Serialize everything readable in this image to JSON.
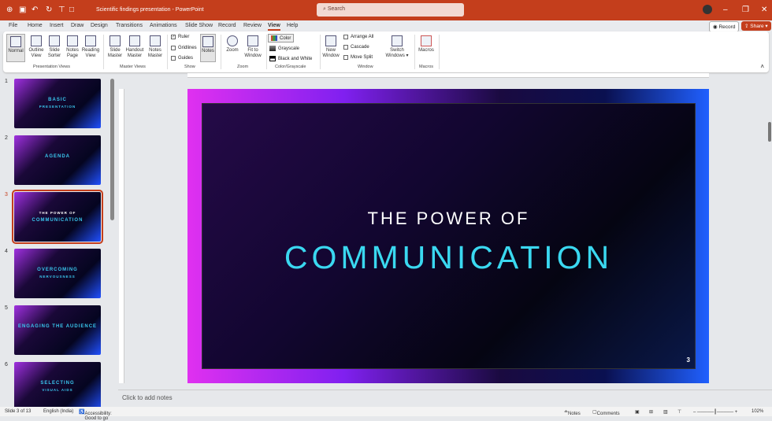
{
  "titlebar": {
    "doc_title": "Scientific findings presentation - PowerPoint",
    "search_placeholder": "Search",
    "record": "Record",
    "share": "Share"
  },
  "menu": [
    "File",
    "Home",
    "Insert",
    "Draw",
    "Design",
    "Transitions",
    "Animations",
    "Slide Show",
    "Record",
    "Review",
    "View",
    "Help"
  ],
  "ribbon": {
    "presentation_views": [
      "Normal",
      "Outline View",
      "Slide Sorter",
      "Notes Page",
      "Reading View"
    ],
    "master_views": [
      "Slide Master",
      "Handout Master",
      "Notes Master"
    ],
    "show": {
      "ruler": "Ruler",
      "gridlines": "Gridlines",
      "guides": "Guides",
      "notes": "Notes"
    },
    "zoom": [
      "Zoom",
      "Fit to Window"
    ],
    "color": [
      "Color",
      "Grayscale",
      "Black and White"
    ],
    "window": {
      "new": "New Window",
      "arrange": "Arrange All",
      "cascade": "Cascade",
      "move": "Move Split",
      "switch": "Switch Windows"
    },
    "macros": "Macros",
    "groups": [
      "Presentation Views",
      "Master Views",
      "Show",
      "Zoom",
      "Color/Grayscale",
      "Window",
      "Macros"
    ]
  },
  "thumbnails": [
    {
      "n": "1",
      "t1": "BASIC",
      "t2": "PRESENTATION"
    },
    {
      "n": "2",
      "t1": "AGENDA",
      "t2": ""
    },
    {
      "n": "3",
      "t1": "THE POWER OF",
      "t2": "COMMUNICATION"
    },
    {
      "n": "4",
      "t1": "OVERCOMING",
      "t2": "NERVOUSNESS"
    },
    {
      "n": "5",
      "t1": "ENGAGING THE AUDIENCE",
      "t2": ""
    },
    {
      "n": "6",
      "t1": "SELECTING",
      "t2": "VISUAL AIDS"
    }
  ],
  "slide": {
    "line1": "THE POWER OF",
    "line2": "COMMUNICATION",
    "number": "3"
  },
  "notes_placeholder": "Click to add notes",
  "status": {
    "slide": "Slide 3 of 13",
    "language": "English (India)",
    "accessibility": "Accessibility: Good to go",
    "notes": "Notes",
    "comments": "Comments",
    "zoom": "102%"
  }
}
